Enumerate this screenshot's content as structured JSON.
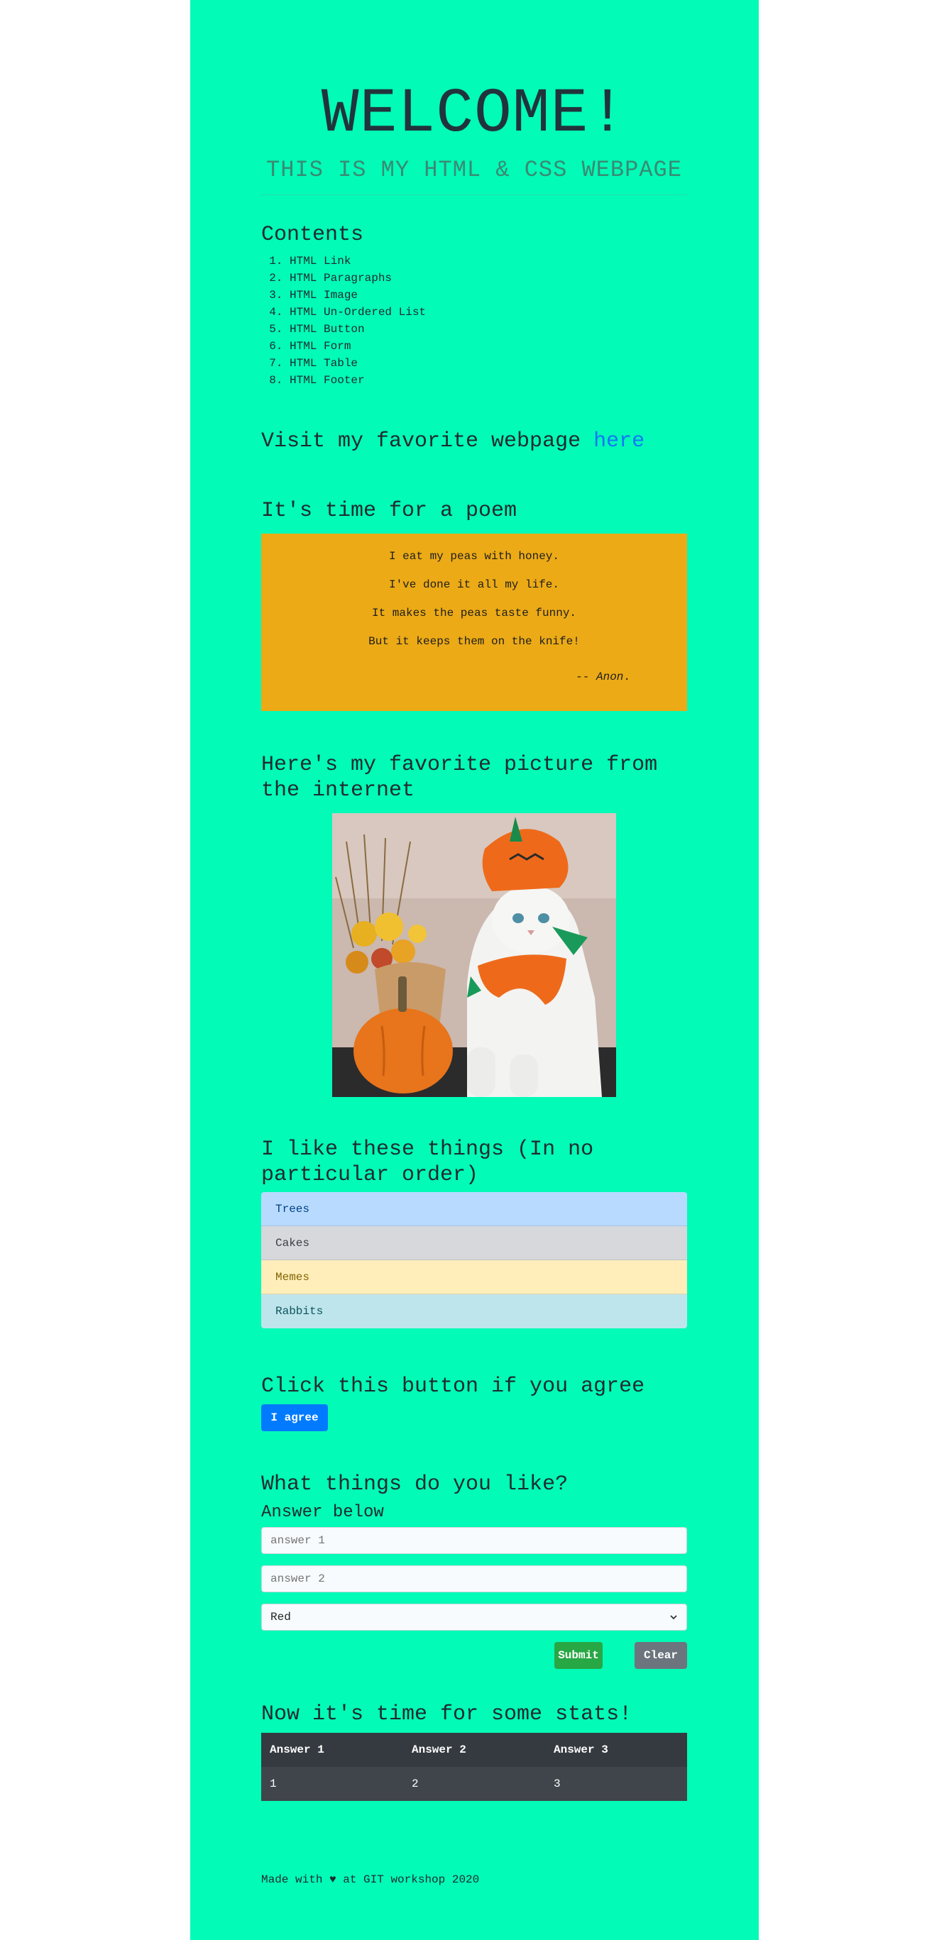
{
  "header": {
    "title": "WELCOME!",
    "subtitle": "THIS IS MY HTML & CSS WEBPAGE"
  },
  "contents": {
    "title": "Contents",
    "items": [
      "HTML Link",
      "HTML Paragraphs",
      "HTML Image",
      "HTML Un-Ordered List",
      "HTML Button",
      "HTML Form",
      "HTML Table",
      "HTML Footer"
    ]
  },
  "link_section": {
    "text": "Visit my favorite webpage ",
    "link_text": "here"
  },
  "poem": {
    "heading": "It's time for a poem",
    "lines": [
      "I eat my peas with honey.",
      "I've done it all my life.",
      "It makes the peas taste funny.",
      "But it keeps them on the knife!"
    ],
    "attribution_prefix": "-- ",
    "attribution_name": "Anon",
    "attribution_suffix": "."
  },
  "picture": {
    "heading": "Here's my favorite picture from the internet"
  },
  "likes": {
    "heading": "I like these things (In no particular order)",
    "items": [
      {
        "label": "Trees",
        "bg": "#b8daff",
        "color": "#004085"
      },
      {
        "label": "Cakes",
        "bg": "#d6d8db",
        "color": "#383d41"
      },
      {
        "label": "Memes",
        "bg": "#ffeeba",
        "color": "#856404"
      },
      {
        "label": "Rabbits",
        "bg": "#bee5eb",
        "color": "#0c5460"
      }
    ]
  },
  "agree": {
    "heading": "Click this button if you agree",
    "button_label": "I agree",
    "button_color": "#007bff"
  },
  "form": {
    "heading": "What things do you like?",
    "subheading": "Answer below",
    "answer1_placeholder": "answer 1",
    "answer2_placeholder": "answer 2",
    "select_value": "Red",
    "submit_label": "Submit",
    "clear_label": "Clear",
    "submit_color": "#28a745",
    "clear_color": "#6c757d"
  },
  "stats": {
    "heading": "Now it's time for some stats!",
    "headers": [
      "Answer 1",
      "Answer 2",
      "Answer 3"
    ],
    "row": [
      "1",
      "2",
      "3"
    ]
  },
  "footer": {
    "prefix": "Made with ",
    "heart": "♥",
    "suffix": " at GIT workshop 2020"
  },
  "colors": {
    "page_bg": "#02fbb7",
    "poem_bg": "#ecaa16",
    "link": "#1178f5"
  }
}
